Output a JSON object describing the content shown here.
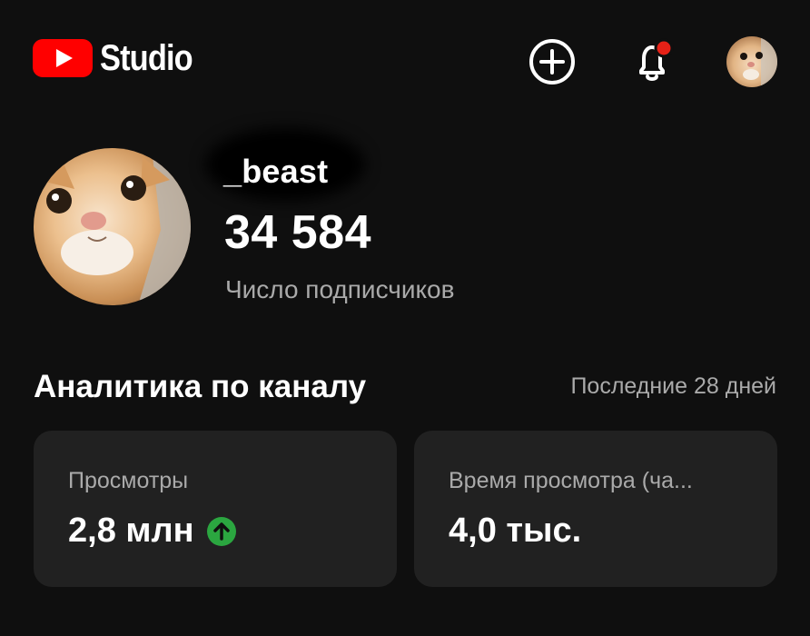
{
  "header": {
    "brand": "Studio",
    "icons": {
      "logo": "youtube-play-logo",
      "create": "plus-circle-icon",
      "notifications": "bell-icon",
      "avatar": "cat-avatar"
    },
    "notification_dot_color": "#e62117",
    "logo_color": "#ff0000"
  },
  "channel": {
    "name": "_beast",
    "subscribers": "34 584",
    "subscribers_label": "Число подписчиков"
  },
  "analytics": {
    "title": "Аналитика по каналу",
    "period": "Последние 28 дней",
    "cards": [
      {
        "label": "Просмотры",
        "value": "2,8 млн",
        "trend": "up-arrow-icon",
        "trend_color": "#2ba640"
      },
      {
        "label": "Время просмотра (ча...",
        "value": "4,0 тыс."
      }
    ]
  }
}
